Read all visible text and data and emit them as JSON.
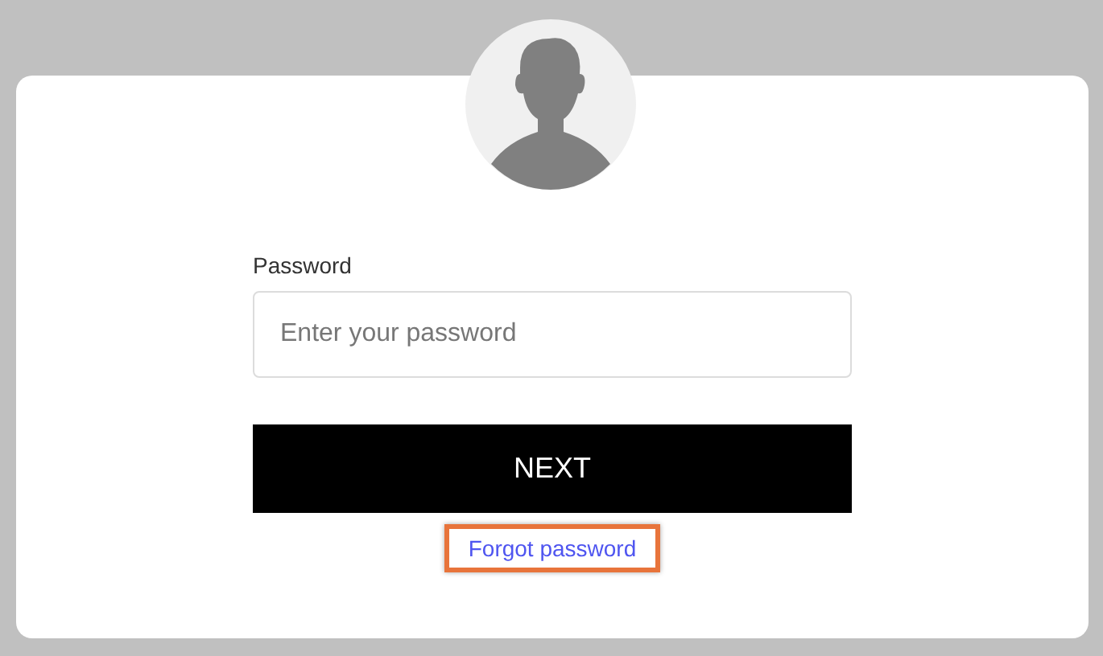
{
  "password_field": {
    "label": "Password",
    "placeholder": "Enter your password"
  },
  "next_button": {
    "label": "NEXT"
  },
  "forgot_link": {
    "label": "Forgot password",
    "highlighted": true
  }
}
